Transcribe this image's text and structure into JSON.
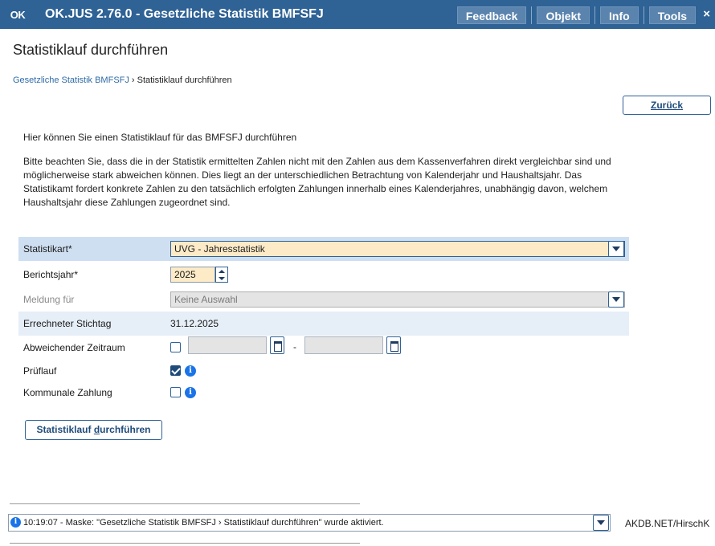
{
  "titlebar": {
    "logo": "OK",
    "title": "OK.JUS 2.76.0 - Gesetzliche Statistik BMFSFJ",
    "buttons": [
      "Feedback",
      "Objekt",
      "Info",
      "Tools"
    ],
    "close": "×"
  },
  "page": {
    "title": "Statistiklauf durchführen",
    "breadcrumb_link": "Gesetzliche Statistik BMFSFJ",
    "breadcrumb_sep": " › ",
    "breadcrumb_current": "Statistiklauf durchführen",
    "back_label": "Zurück",
    "intro": "Hier können Sie einen Statistiklauf für das BMFSFJ durchführen",
    "notice": "Bitte beachten Sie, dass die in der Statistik ermittelten Zahlen nicht mit den Zahlen aus dem Kassenverfahren direkt vergleichbar sind und möglicherweise stark abweichen können. Dies liegt an der unterschiedlichen Betrachtung von Kalenderjahr und Haushaltsjahr. Das Statistikamt fordert konkrete Zahlen zu den tatsächlich erfolgten Zahlungen innerhalb eines Kalenderjahres, unabhängig davon, welchem Haushaltsjahr diese Zahlungen zugeordnet sind."
  },
  "form": {
    "statistikart": {
      "label": "Statistikart*",
      "value": "UVG - Jahresstatistik"
    },
    "berichtsjahr": {
      "label": "Berichtsjahr*",
      "value": "2025"
    },
    "meldung": {
      "label": "Meldung für",
      "value": "Keine Auswahl"
    },
    "stichtag": {
      "label": "Errechneter Stichtag",
      "value": "31.12.2025"
    },
    "zeitraum": {
      "label": "Abweichender Zeitraum",
      "checked": false,
      "separator": "-"
    },
    "pruflauf": {
      "label": "Prüflauf",
      "checked": true
    },
    "kommunal": {
      "label": "Kommunale Zahlung",
      "checked": false
    },
    "run_label_pre": "Statistiklauf ",
    "run_label_accel": "d",
    "run_label_post": "urchführen"
  },
  "status": {
    "message": "10:19:07 - Maske: \"Gesetzliche Statistik BMFSFJ › Statistiklauf durchführen\" wurde aktiviert.",
    "user": "AKDB.NET/HirschK"
  },
  "colors": {
    "titlebar": "#2f6295",
    "accent": "#1e4b7a",
    "highlight_row": "#cfdff2",
    "active_field": "#fdebc8"
  }
}
